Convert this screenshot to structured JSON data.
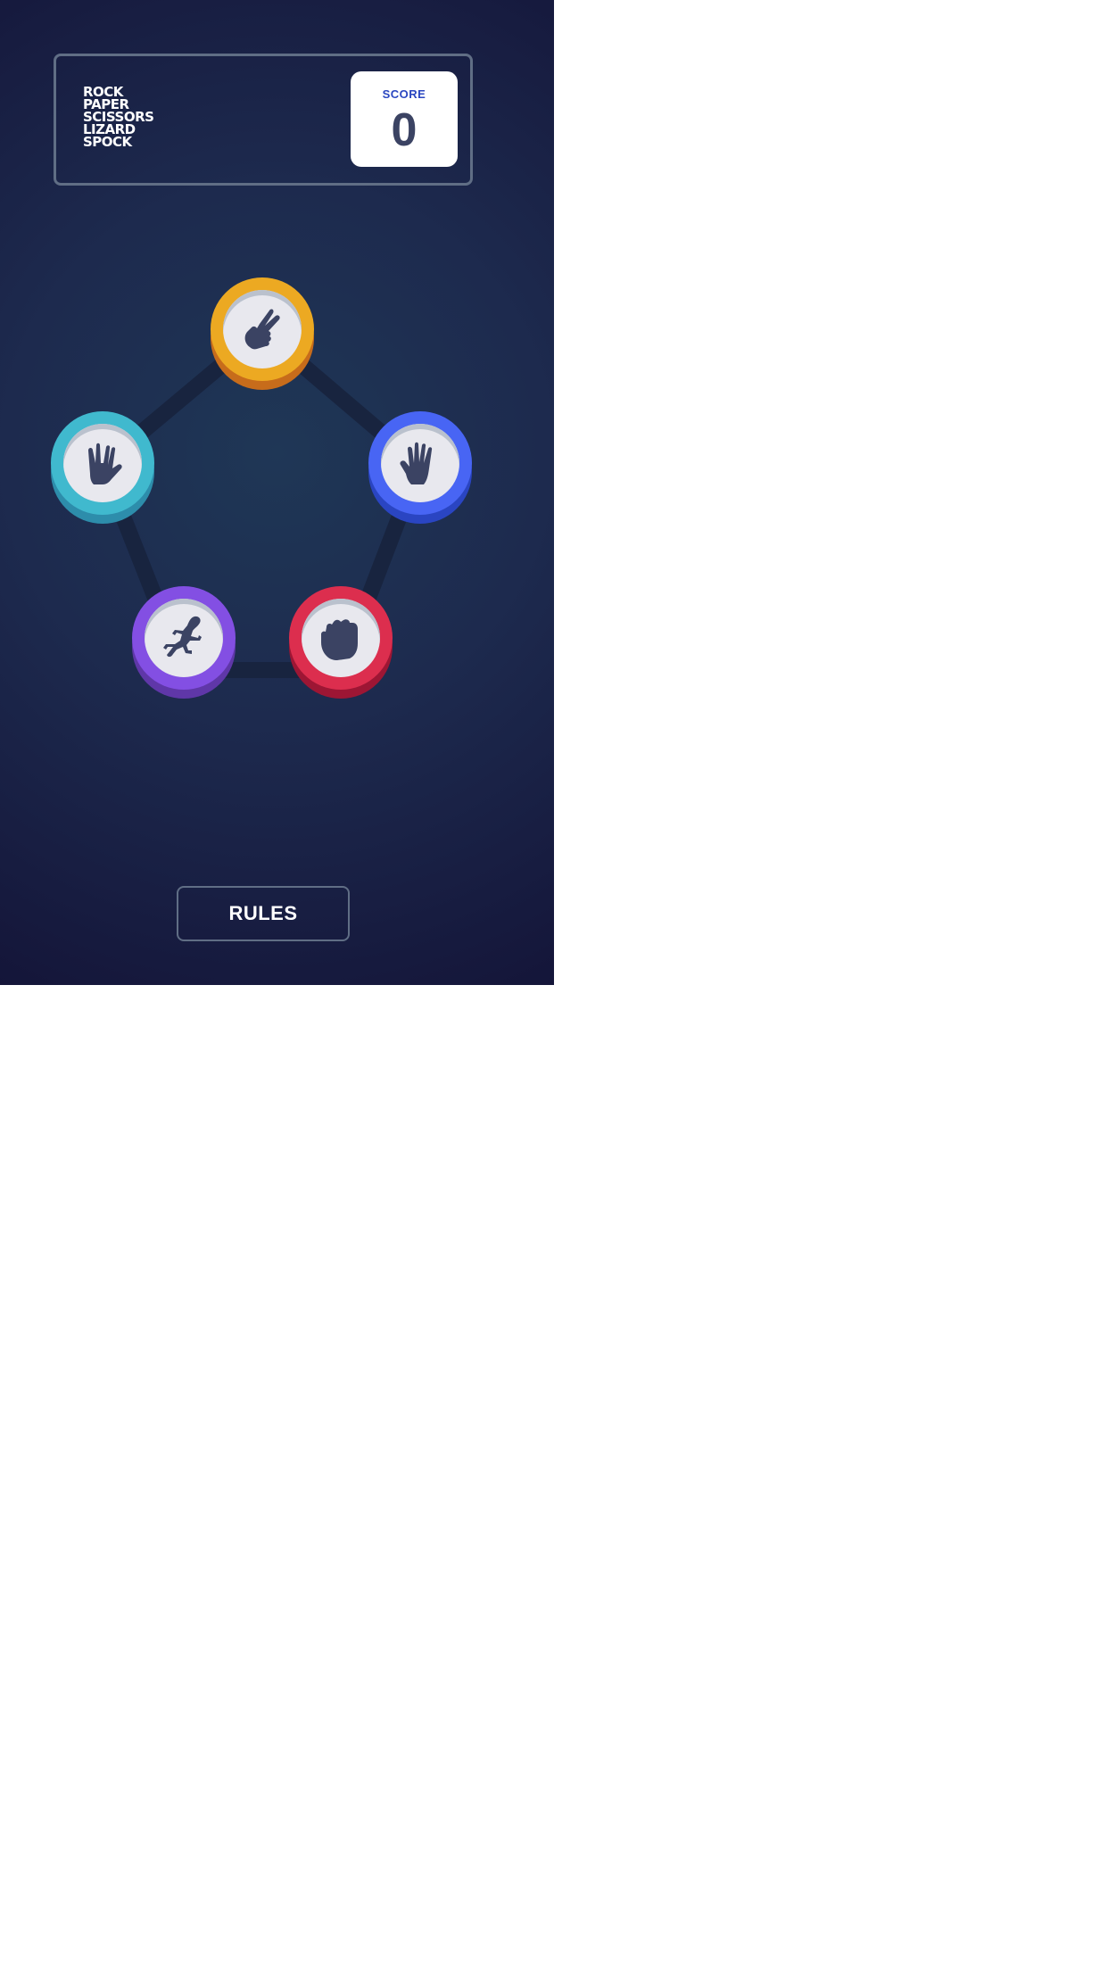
{
  "game": {
    "title_lines": [
      "ROCK",
      "PAPER",
      "SCISSORS",
      "LIZARD",
      "SPOCK"
    ],
    "score_label": "SCORE",
    "score_value": "0",
    "rules_label": "RULES"
  },
  "tokens": [
    {
      "name": "scissors",
      "icon": "scissors-hand-icon",
      "color": "#eca922",
      "shadow": "#c76c1b"
    },
    {
      "name": "paper",
      "icon": "paper-hand-icon",
      "color": "#4865f4",
      "shadow": "#2a45c2"
    },
    {
      "name": "rock",
      "icon": "rock-fist-icon",
      "color": "#dc2e4e",
      "shadow": "#9d1634"
    },
    {
      "name": "lizard",
      "icon": "lizard-icon",
      "color": "#834fe3",
      "shadow": "#5f37a8"
    },
    {
      "name": "spock",
      "icon": "spock-hand-icon",
      "color": "#40b9ce",
      "shadow": "#2d8dab"
    }
  ],
  "colors": {
    "background_light": "#1f3756",
    "background_dark": "#141539",
    "outline": "#606e85",
    "pentagon_line": "#18243f",
    "icon_fill": "#3b4363"
  }
}
